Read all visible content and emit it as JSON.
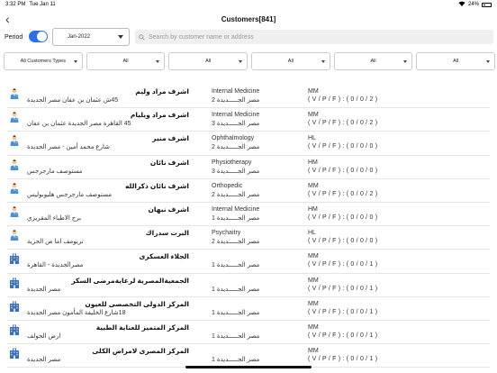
{
  "status_bar": {
    "time": "3:32 PM",
    "date": "Tue Jan 11",
    "battery": "24%"
  },
  "header": {
    "back_icon": "chevron-left-icon",
    "title": "Customers[841]"
  },
  "period": {
    "label": "Period",
    "toggle_on": true,
    "date_value": "Jan-2022"
  },
  "search": {
    "placeholder": "Search by customer name or address"
  },
  "filters": [
    "All Customers Types",
    "All",
    "All",
    "All",
    "All",
    "All"
  ],
  "colors": {
    "accent": "#2f6fe4",
    "doctor_coat": "#4a90d9",
    "building": "#3b6fb6"
  },
  "customers": [
    {
      "type": "doctor",
      "name": "اشرف مراد وليم",
      "address": "45ش عثمان بن عفان مصر الجديدة",
      "specialty": "Internal Medicine",
      "area": "مصر الجـــــديدة 2",
      "class": "MM",
      "vpf": "( V / P / F ) : ( 0 / 0 / 2 )"
    },
    {
      "type": "doctor",
      "name": "اشرف مراد ويليام",
      "address": "45 القاهرة مصر الجديدة عثمان بن عفان",
      "specialty": "Internal Medicine",
      "area": "مصر الجـــــديدة 3",
      "class": "MM",
      "vpf": "( V / P / F ) : ( 0 / 0 / 2 )"
    },
    {
      "type": "doctor",
      "name": "اشرف منير",
      "address": "شارع محمد أمين - مصر الجديدة",
      "specialty": "Ophthalmology",
      "area": "مصر الجـــــديدة 2",
      "class": "HL",
      "vpf": "( V / P / F ) : ( 0 / 0 / 0 )"
    },
    {
      "type": "doctor",
      "name": "اشرف نائان",
      "address": "مستوصف مارجرجس",
      "specialty": "Physiotherapy",
      "area": "مصر الجـــــديدة 3",
      "class": "HM",
      "vpf": "( V / P / F ) : ( 0 / 0 / 0 )"
    },
    {
      "type": "doctor",
      "name": "اشرف نائان ذكرالله",
      "address": "مستوصف مارجرجس هليوبوليس",
      "specialty": "Orthopedic",
      "area": "مصر الجـــــديدة 2",
      "class": "MM",
      "vpf": "( V / P / F ) : ( 0 / 0 / 2 )"
    },
    {
      "type": "doctor",
      "name": "اشرف نبهان",
      "address": "برج الاطباء المقريزي",
      "specialty": "Internal Medicine",
      "area": "مصر الجـــــديدة 1",
      "class": "HM",
      "vpf": "( V / P / F ) : ( 0 / 0 / 0 )"
    },
    {
      "type": "doctor",
      "name": "البرت سدراك",
      "address": "تريومف اما ص الحرية",
      "specialty": "Psychaitry",
      "area": "مصر الجـــــديدة 2",
      "class": "HL",
      "vpf": "( V / P / F ) : ( 0 / 0 / 0 )"
    },
    {
      "type": "hospital",
      "name": "الجلاء العسكرى",
      "address": "مصرالجديدة - القاهرة",
      "specialty": "",
      "area": "مصر الجـــــديدة 1",
      "class": "MM",
      "vpf": "( V / P / F ) : ( 0 / 0 / 1 )"
    },
    {
      "type": "hospital",
      "name": "الجمعيةالمصرية لرعايةمرضى السكر",
      "address": "مصر الجديدة",
      "specialty": "",
      "area": "مصر الجـــــديدة 1",
      "class": "MM",
      "vpf": "( V / P / F ) : ( 0 / 0 / 1 )"
    },
    {
      "type": "hospital",
      "name": "المركز الدولى التخصصى للعيون",
      "address": "18شارع الخليفة المأمون مصر الجديدة",
      "specialty": "",
      "area": "مصر الجـــــديدة 1",
      "class": "MM",
      "vpf": "( V / P / F ) : ( 0 / 0 / 1 )"
    },
    {
      "type": "hospital",
      "name": "المركز المتميز للعناية الطبية",
      "address": "ارض الجولف",
      "specialty": "",
      "area": "مصر الجـــــديدة 1",
      "class": "MM",
      "vpf": "( V / P / F ) : ( 0 / 0 / 1 )"
    },
    {
      "type": "hospital",
      "name": "المركز المصرى لامراض الكلى",
      "address": "مصر الجديدة",
      "specialty": "",
      "area": "مصر الجـــــديدة 1",
      "class": "MM",
      "vpf": "( V / P / F ) : ( 0 / 0 / 1 )"
    }
  ]
}
